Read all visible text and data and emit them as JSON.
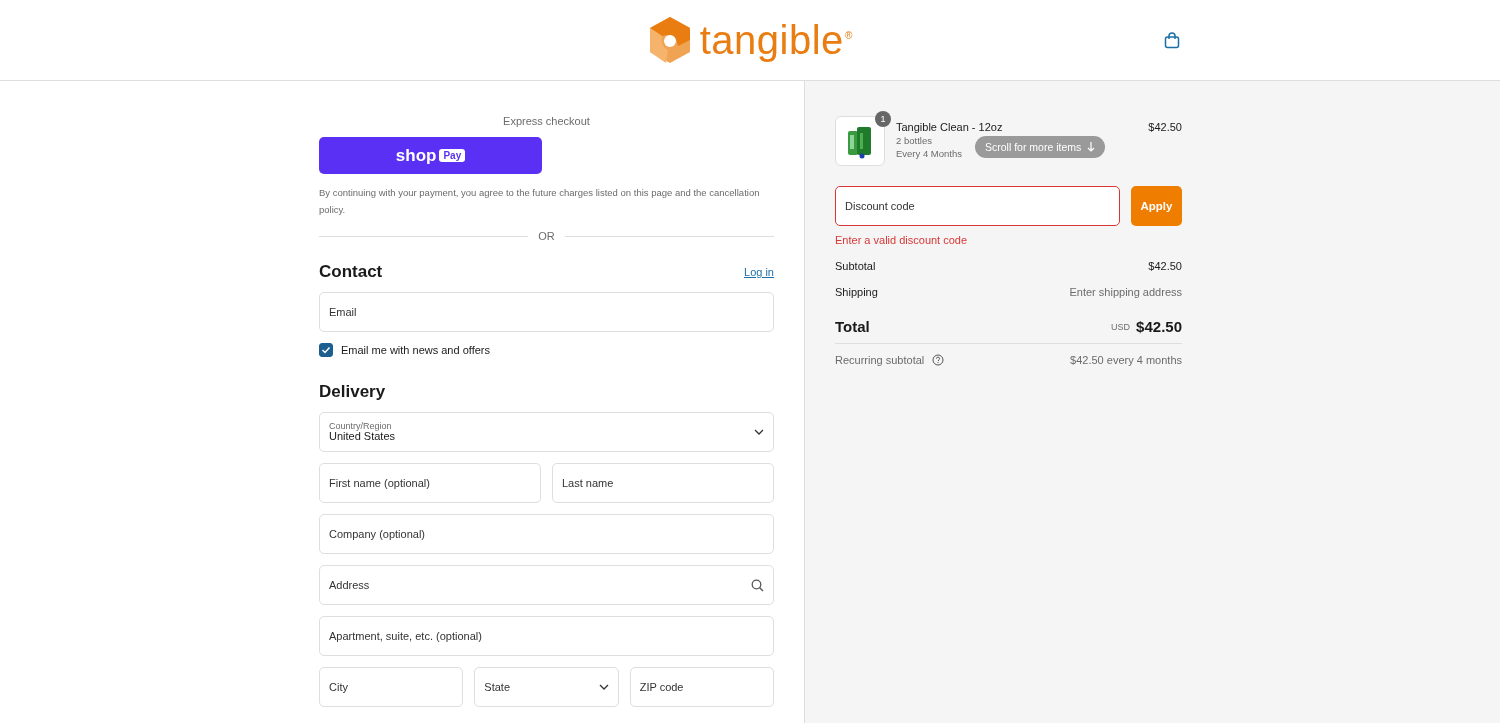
{
  "header": {
    "brand": "tangible",
    "brand_mark": "®"
  },
  "express": {
    "title": "Express checkout",
    "shop_pay": {
      "word": "shop",
      "badge": "Pay"
    },
    "notice": "By continuing with your payment, you agree to the future charges listed on this page and the cancellation policy.",
    "divider": "OR"
  },
  "contact": {
    "title": "Contact",
    "login": "Log in",
    "email": {
      "placeholder": "Email"
    },
    "newsletter": {
      "label": "Email me with news and offers",
      "checked": true
    }
  },
  "delivery": {
    "title": "Delivery",
    "rows": [
      [
        {
          "kind": "select",
          "label": "Country/Region",
          "value": "United States"
        }
      ],
      [
        {
          "kind": "text",
          "placeholder": "First name (optional)"
        },
        {
          "kind": "text",
          "placeholder": "Last name"
        }
      ],
      [
        {
          "kind": "text",
          "placeholder": "Company (optional)"
        }
      ],
      [
        {
          "kind": "search",
          "placeholder": "Address"
        }
      ],
      [
        {
          "kind": "text",
          "placeholder": "Apartment, suite, etc. (optional)"
        }
      ],
      [
        {
          "kind": "text",
          "placeholder": "City"
        },
        {
          "kind": "select",
          "placeholder": "State"
        },
        {
          "kind": "text",
          "placeholder": "ZIP code"
        }
      ]
    ]
  },
  "summary": {
    "items": [
      {
        "name": "Tangible Clean - 12oz",
        "quantity": "1",
        "details": [
          "2 bottles",
          "Every 4 Months"
        ],
        "price": "$42.50"
      }
    ],
    "scroll_hint": "Scroll for more items",
    "discount": {
      "placeholder": "Discount code",
      "invalid": true,
      "error": "Enter a valid discount code",
      "button": "Apply"
    },
    "lines": [
      {
        "label": "Subtotal",
        "value": "$42.50",
        "muted": false
      },
      {
        "label": "Shipping",
        "value": "Enter shipping address",
        "muted": true
      }
    ],
    "total": {
      "label": "Total",
      "currency": "USD",
      "value": "$42.50"
    },
    "recurring": {
      "label": "Recurring subtotal",
      "value": "$42.50 every 4 months"
    }
  }
}
